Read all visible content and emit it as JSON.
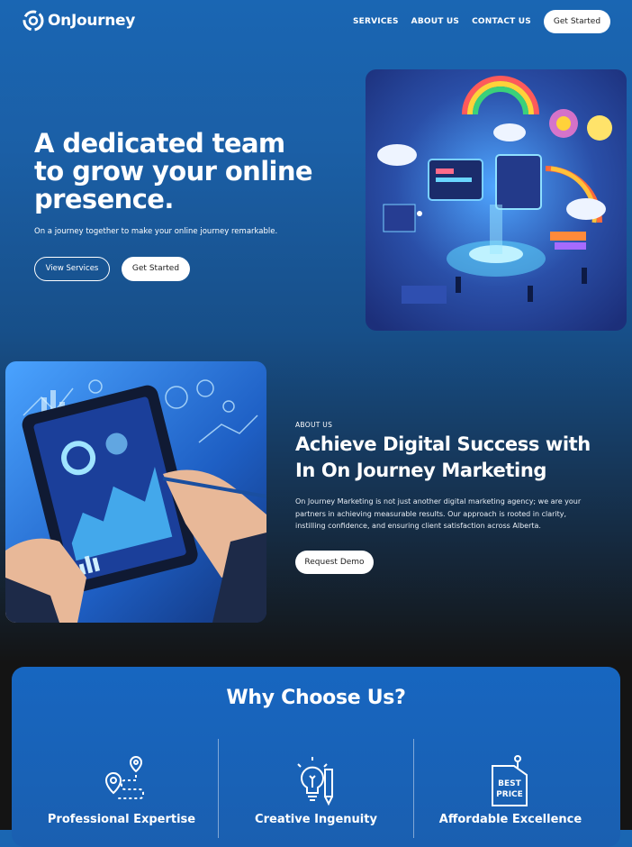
{
  "nav": {
    "brand": "OnJourney",
    "links": [
      "SERVICES",
      "ABOUT US",
      "CONTACT US"
    ],
    "cta": "Get Started"
  },
  "hero": {
    "title": "A dedicated team to grow your online presence.",
    "subtitle": "On a journey together to make your online journey remarkable.",
    "btn_services": "View Services",
    "btn_start": "Get Started"
  },
  "about": {
    "label": "ABOUT US",
    "title": "Achieve Digital Success with In On Journey Marketing",
    "text": "On Journey Marketing is not just another digital marketing agency; we are your partners in achieving measurable results. Our approach is rooted in clarity, instilling confidence, and ensuring client satisfaction across Alberta.",
    "cta": "Request Demo"
  },
  "why": {
    "title": "Why Choose Us?",
    "features": [
      {
        "label": "Professional Expertise",
        "icon": "route-map-icon"
      },
      {
        "label": "Creative Ingenuity",
        "icon": "lightbulb-pencil-icon"
      },
      {
        "label": "Affordable Excellence",
        "icon": "best-price-tag-icon",
        "tag_line1": "BEST",
        "tag_line2": "PRICE"
      }
    ]
  },
  "colors": {
    "accent": "#1a66b3",
    "dark_bg": "#141414",
    "button_bg": "#ffffff"
  }
}
